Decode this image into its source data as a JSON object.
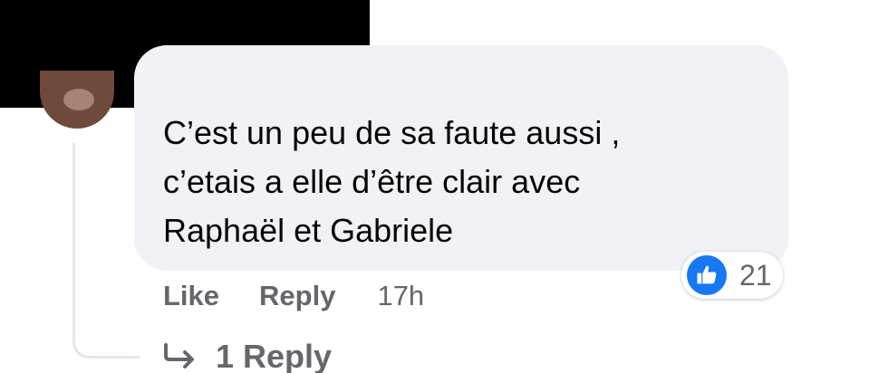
{
  "comment": {
    "lines": [
      "C’est un peu de sa faute aussi ,",
      "c’etais a elle d’être clair avec",
      "Raphaël et Gabriele"
    ],
    "reaction_count": "21",
    "actions": {
      "like": "Like",
      "reply": "Reply",
      "timestamp": "17h"
    }
  },
  "replies": {
    "label": "1 Reply"
  },
  "icons": {
    "reaction": "like-icon",
    "replies": "reply-arrow-icon"
  },
  "colors": {
    "bubble": "#f0f2f5",
    "accent": "#1877f2",
    "muted_text": "#65676b",
    "text": "#050505"
  }
}
